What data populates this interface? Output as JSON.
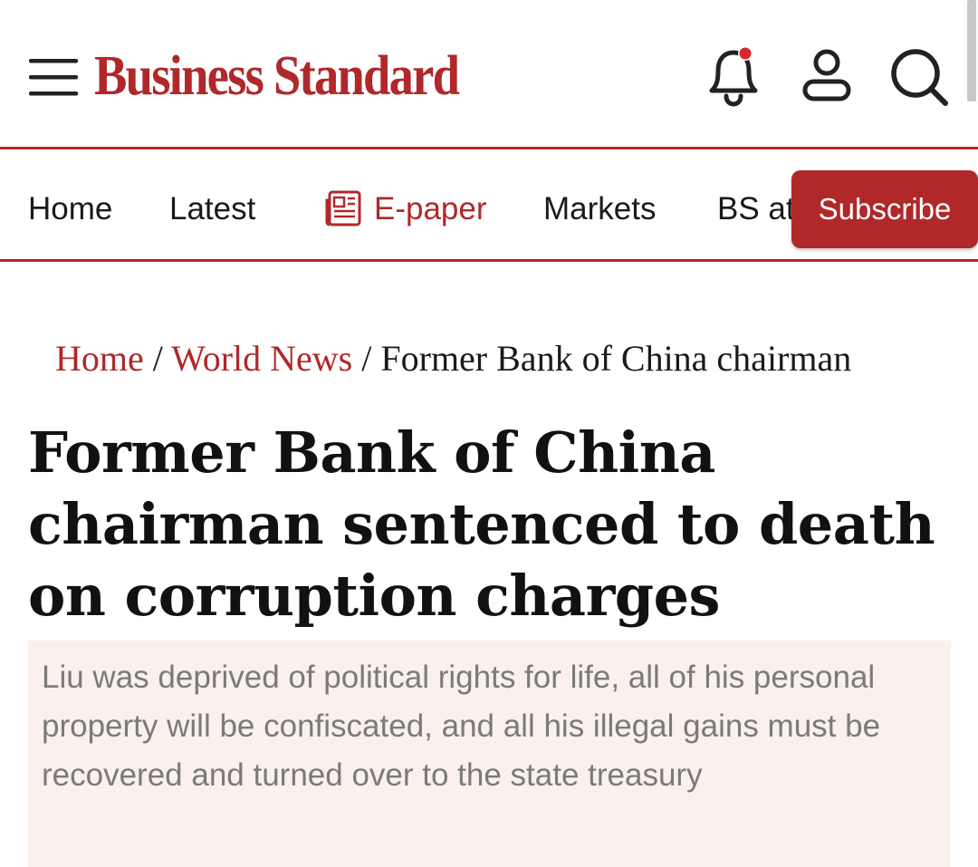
{
  "header": {
    "logo_text": "Business Standard",
    "brand_color": "#b0282a",
    "icons": [
      "menu-icon",
      "bell-icon",
      "user-icon",
      "search-icon"
    ],
    "notification_dot_color": "#d6282b"
  },
  "nav": {
    "items": [
      {
        "label": "Home"
      },
      {
        "label": "Latest"
      },
      {
        "label": "E-paper",
        "icon": "newspaper-icon",
        "color": "#b0282a"
      },
      {
        "label": "Markets"
      },
      {
        "label": "BS at"
      }
    ],
    "subscribe_label": "Subscribe"
  },
  "breadcrumb": {
    "home": "Home",
    "separator": "/",
    "section": "World News",
    "current": "Former Bank of China chairman"
  },
  "article": {
    "headline": "Former Bank of China chairman sentenced to death on corruption charges",
    "summary": "Liu was deprived of political rights for life, all of his personal property will be confiscated, and all his illegal gains must be recovered and turned over to the state treasury",
    "summary_bg": "#fbf1ec"
  }
}
